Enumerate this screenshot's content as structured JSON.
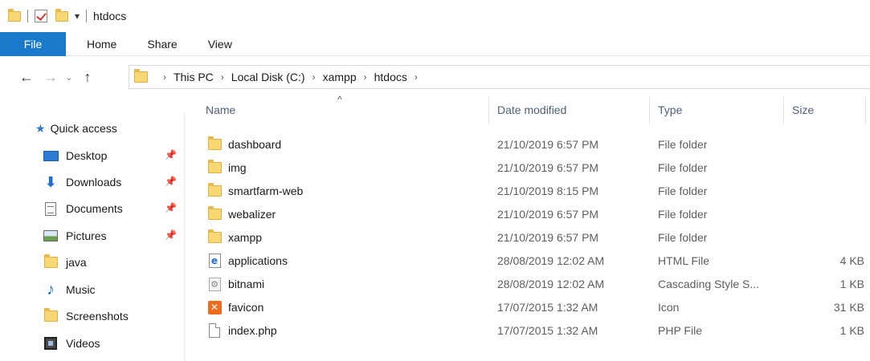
{
  "window": {
    "title": "htdocs"
  },
  "quick_toolbar": {
    "dropdown_glyph": "▾"
  },
  "ribbon": {
    "tabs": [
      "File",
      "Home",
      "Share",
      "View"
    ]
  },
  "nav": {
    "back": "←",
    "forward": "→",
    "recent": "⌄",
    "up": "↑"
  },
  "address": {
    "separator": "›",
    "crumbs": [
      "This PC",
      "Local Disk (C:)",
      "xampp",
      "htdocs"
    ]
  },
  "sidebar": {
    "quick_access": "Quick access",
    "pin_glyph": "📌",
    "items": [
      {
        "label": "Desktop",
        "icon": "desktop-icon",
        "pinned": true
      },
      {
        "label": "Downloads",
        "icon": "download-arrow-icon",
        "pinned": true
      },
      {
        "label": "Documents",
        "icon": "documents-icon",
        "pinned": true
      },
      {
        "label": "Pictures",
        "icon": "pictures-icon",
        "pinned": true
      },
      {
        "label": "java",
        "icon": "folder-icon",
        "pinned": false
      },
      {
        "label": "Music",
        "icon": "music-note-icon",
        "pinned": false
      },
      {
        "label": "Screenshots",
        "icon": "folder-icon",
        "pinned": false
      },
      {
        "label": "Videos",
        "icon": "videos-icon",
        "pinned": false
      }
    ]
  },
  "file_list": {
    "sort_glyph": "^",
    "columns": {
      "name": "Name",
      "date": "Date modified",
      "type": "Type",
      "size": "Size"
    },
    "rows": [
      {
        "name": "dashboard",
        "date": "21/10/2019 6:57 PM",
        "type": "File folder",
        "size": "",
        "icon": "folder-icon"
      },
      {
        "name": "img",
        "date": "21/10/2019 6:57 PM",
        "type": "File folder",
        "size": "",
        "icon": "folder-icon"
      },
      {
        "name": "smartfarm-web",
        "date": "21/10/2019 8:15 PM",
        "type": "File folder",
        "size": "",
        "icon": "folder-icon"
      },
      {
        "name": "webalizer",
        "date": "21/10/2019 6:57 PM",
        "type": "File folder",
        "size": "",
        "icon": "folder-icon"
      },
      {
        "name": "xampp",
        "date": "21/10/2019 6:57 PM",
        "type": "File folder",
        "size": "",
        "icon": "folder-icon"
      },
      {
        "name": "applications",
        "date": "28/08/2019 12:02 AM",
        "type": "HTML File",
        "size": "4 KB",
        "icon": "html-file-icon"
      },
      {
        "name": "bitnami",
        "date": "28/08/2019 12:02 AM",
        "type": "Cascading Style S...",
        "size": "1 KB",
        "icon": "css-file-icon"
      },
      {
        "name": "favicon",
        "date": "17/07/2015 1:32 AM",
        "type": "Icon",
        "size": "31 KB",
        "icon": "xampp-favicon-icon"
      },
      {
        "name": "index.php",
        "date": "17/07/2015 1:32 AM",
        "type": "PHP File",
        "size": "1 KB",
        "icon": "blank-file-icon"
      }
    ]
  },
  "colors": {
    "file_tab": "#1979ca",
    "header_text": "#4c607a",
    "folder": "#f8d775",
    "accent_blue": "#1e6fd0"
  }
}
